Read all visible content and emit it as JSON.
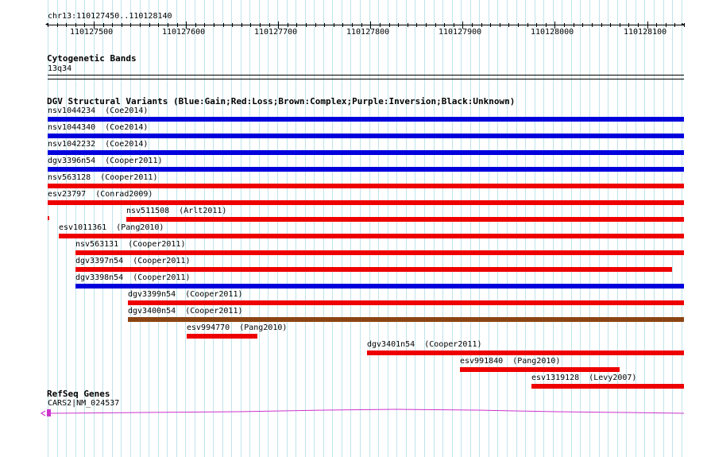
{
  "region": {
    "label": "chr13:110127450..110128140",
    "start": 110127450,
    "end": 110128140
  },
  "ruler": {
    "ticks": [
      "110127500",
      "110127600",
      "110127700",
      "110127800",
      "110127900",
      "110128000",
      "110128100"
    ]
  },
  "cytobands": {
    "title": "Cytogenetic Bands",
    "band": "13q34"
  },
  "dgv": {
    "title": "DGV Structural Variants (Blue:Gain;Red:Loss;Brown:Complex;Purple:Inversion;Black:Unknown)",
    "colors": {
      "gain": "#0000dd",
      "loss": "#ee0000",
      "complex": "#8b4513"
    },
    "variants": [
      {
        "label": "nsv1044234  (Coe2014)",
        "start": 110127450,
        "end": 110128140,
        "type": "gain"
      },
      {
        "label": "nsv1044340  (Coe2014)",
        "start": 110127450,
        "end": 110128140,
        "type": "gain"
      },
      {
        "label": "nsv1042232  (Coe2014)",
        "start": 110127450,
        "end": 110128140,
        "type": "gain"
      },
      {
        "label": "dgv3396n54  (Cooper2011)",
        "start": 110127450,
        "end": 110128140,
        "type": "gain"
      },
      {
        "label": "nsv563128  (Cooper2011)",
        "start": 110127450,
        "end": 110128140,
        "type": "loss"
      },
      {
        "label": "esv23797  (Conrad2009)",
        "start": 110127450,
        "end": 110128140,
        "type": "loss"
      },
      {
        "label": "nsv511508  (Arlt2011)",
        "start": 110127535,
        "end": 110128140,
        "type": "loss"
      },
      {
        "label": "esv1011361  (Pang2010)",
        "start": 110127462,
        "end": 110128140,
        "type": "loss"
      },
      {
        "label": "nsv563131  (Cooper2011)",
        "start": 110127480,
        "end": 110128140,
        "type": "loss"
      },
      {
        "label": "dgv3397n54  (Cooper2011)",
        "start": 110127480,
        "end": 110128127,
        "type": "loss"
      },
      {
        "label": "dgv3398n54  (Cooper2011)",
        "start": 110127480,
        "end": 110128140,
        "type": "gain"
      },
      {
        "label": "dgv3399n54  (Cooper2011)",
        "start": 110127537,
        "end": 110128140,
        "type": "loss"
      },
      {
        "label": "dgv3400n54  (Cooper2011)",
        "start": 110127537,
        "end": 110128140,
        "type": "complex"
      },
      {
        "label": "esv994770  (Pang2010)",
        "start": 110127601,
        "end": 110127678,
        "type": "loss"
      },
      {
        "label": "dgv3401n54  (Cooper2011)",
        "start": 110127796,
        "end": 110128140,
        "type": "loss"
      },
      {
        "label": "esv991840  (Pang2010)",
        "start": 110127897,
        "end": 110128070,
        "type": "loss"
      },
      {
        "label": "esv1319128  (Levy2007)",
        "start": 110127975,
        "end": 110128140,
        "type": "loss"
      }
    ]
  },
  "refseq": {
    "title": "RefSeq Genes",
    "gene_label": "CARS2|NM_024537",
    "color": "#cc33cc"
  }
}
